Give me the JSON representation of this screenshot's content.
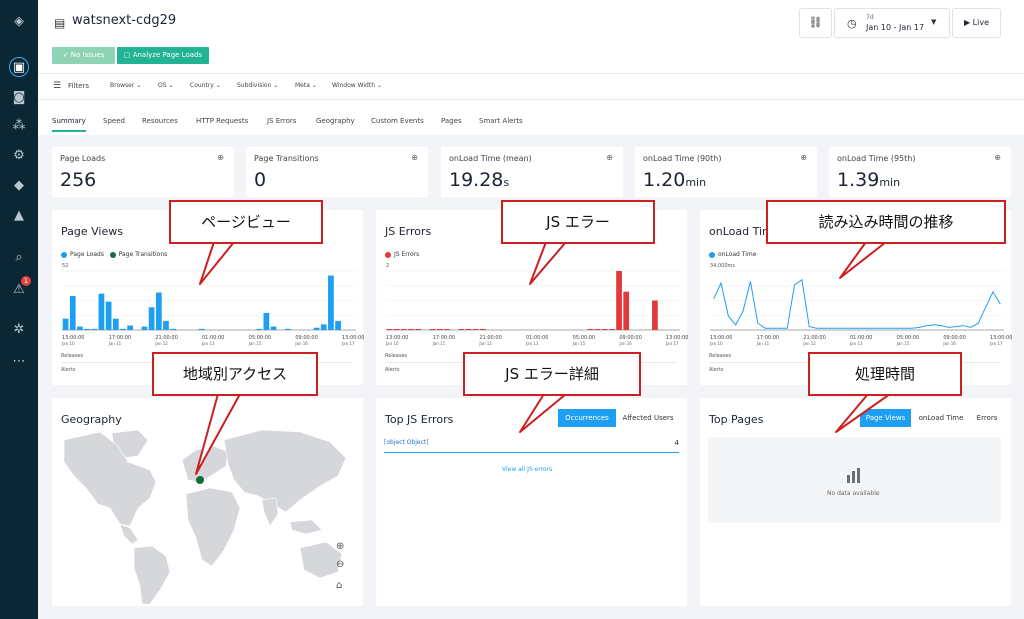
{
  "rail": {
    "icons": [
      "app-logo-icon",
      "dashboard-icon",
      "monitor-icon",
      "cluster-icon",
      "gear-icon",
      "cube-icon",
      "beaker-icon",
      "search-icon",
      "alert-icon",
      "settings-icon",
      "more-icon"
    ],
    "alert_badge": "1"
  },
  "header": {
    "app_title": "watsnext-cdg29",
    "no_issues": "No Issues",
    "analyze": "Analyze Page Loads",
    "range_small": "7d",
    "range": "Jan 10 - Jan 17",
    "live": "Live"
  },
  "filters": {
    "label": "Filters",
    "items": [
      "Browser",
      "OS",
      "Country",
      "Subdivision",
      "Meta",
      "Window Width"
    ]
  },
  "tabs": [
    "Summary",
    "Speed",
    "Resources",
    "HTTP Requests",
    "JS Errors",
    "Geography",
    "Custom Events",
    "Pages",
    "Smart Alerts"
  ],
  "metrics": [
    {
      "label": "Page Loads",
      "value": "256",
      "unit": ""
    },
    {
      "label": "Page Transitions",
      "value": "0",
      "unit": ""
    },
    {
      "label": "onLoad Time (mean)",
      "value": "19.28",
      "unit": "s"
    },
    {
      "label": "onLoad Time (90th)",
      "value": "1.20",
      "unit": "min"
    },
    {
      "label": "onLoad Time (95th)",
      "value": "1.39",
      "unit": "min"
    }
  ],
  "page_views": {
    "title": "Page Views",
    "legend": [
      "Page Loads",
      "Page Transitions"
    ],
    "ymax_label": "52",
    "releases": "Releases",
    "alerts": "Alerts"
  },
  "js_errors": {
    "title": "JS Errors",
    "legend": [
      "JS Errors"
    ],
    "ymax_label": "2",
    "releases": "Releases",
    "alerts": "Alerts"
  },
  "onload": {
    "title": "onLoad Time",
    "legend": [
      "onLoad Time"
    ],
    "ymax_label": "34,000ms",
    "releases": "Releases",
    "alerts": "Alerts"
  },
  "geography": {
    "title": "Geography",
    "zoom_in": "+",
    "zoom_out": "−"
  },
  "top_js_errors": {
    "title": "Top JS Errors",
    "tab_on": "Occurrences",
    "tab_off": "Affected Users",
    "row_name": "[object Object]",
    "row_count": "4",
    "view_all": "View all JS errors"
  },
  "top_pages": {
    "title": "Top Pages",
    "tabs": [
      "Page Views",
      "onLoad Time",
      "Errors"
    ],
    "no_data": "No data available"
  },
  "callouts": {
    "page_view": "ページビュー",
    "js_error": "JS エラー",
    "load_trend": "読み込み時間の推移",
    "region": "地域別アクセス",
    "js_detail": "JS エラー詳細",
    "processing": "処理時間"
  },
  "x_ticks": [
    {
      "t": "13:00:00",
      "d": "Jan 10"
    },
    {
      "t": "17:00:00",
      "d": "Jan 11"
    },
    {
      "t": "21:00:00",
      "d": "Jan 12"
    },
    {
      "t": "01:00:00",
      "d": "Jan 13"
    },
    {
      "t": "05:00:00",
      "d": "Jan 15"
    },
    {
      "t": "09:00:00",
      "d": "Jan 16"
    },
    {
      "t": "13:00:00",
      "d": "Jan 17"
    }
  ],
  "chart_data": [
    {
      "type": "bar",
      "title": "Page Views",
      "ylim": [
        0,
        52
      ],
      "series": [
        {
          "name": "Page Loads",
          "color": "#1e9ff2",
          "values": [
            10,
            30,
            3,
            1,
            1,
            32,
            25,
            10,
            1,
            4,
            0,
            3,
            20,
            33,
            8,
            1,
            0,
            0,
            0,
            1,
            0,
            0,
            0,
            0,
            0,
            0,
            0,
            1,
            15,
            3,
            0,
            1,
            0,
            0,
            0,
            2,
            5,
            48,
            8,
            0,
            0
          ]
        },
        {
          "name": "Page Transitions",
          "color": "#0f6b5a",
          "values": []
        }
      ]
    },
    {
      "type": "bar",
      "title": "JS Errors",
      "ylim": [
        0,
        2
      ],
      "series": [
        {
          "name": "JS Errors",
          "color": "#e03a3a",
          "values": [
            0.03,
            0.03,
            0.03,
            0.03,
            0.03,
            0,
            0.03,
            0.03,
            0.03,
            0,
            0.03,
            0.03,
            0.03,
            0.03,
            0,
            0,
            0,
            0,
            0,
            0,
            0,
            0,
            0,
            0,
            0,
            0,
            0,
            0,
            0.03,
            0.03,
            0.03,
            0.03,
            2,
            1.3,
            0,
            0,
            0,
            1,
            0,
            0,
            0
          ]
        }
      ]
    },
    {
      "type": "line",
      "title": "onLoad Time",
      "ylim": [
        0,
        34000
      ],
      "series": [
        {
          "name": "onLoad Time",
          "color": "#1e9ff2",
          "values": [
            18000,
            27000,
            8000,
            3000,
            11000,
            28000,
            4000,
            1000,
            1000,
            1000,
            1000,
            26000,
            29000,
            2000,
            1000,
            1000,
            1000,
            1000,
            1000,
            1000,
            1000,
            1000,
            1000,
            1000,
            1000,
            1000,
            1000,
            1000,
            1500,
            2500,
            3000,
            2500,
            1500,
            2000,
            2500,
            1500,
            4000,
            13000,
            22000,
            15000
          ]
        }
      ]
    }
  ]
}
